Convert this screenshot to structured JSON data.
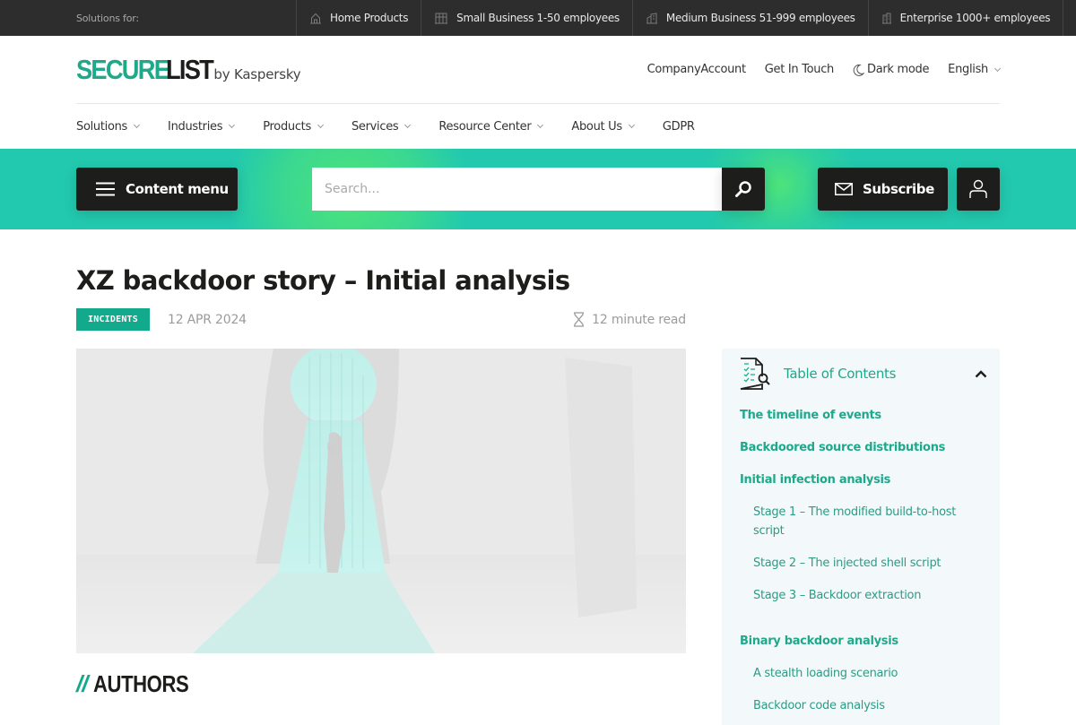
{
  "topbar": {
    "label": "Solutions for:",
    "segments": [
      {
        "label": "Home Products",
        "icon": "home-icon"
      },
      {
        "label": "Small Business 1-50 employees",
        "icon": "small-building-icon"
      },
      {
        "label": "Medium Business 51-999 employees",
        "icon": "medium-building-icon"
      },
      {
        "label": "Enterprise 1000+ employees",
        "icon": "enterprise-building-icon"
      }
    ]
  },
  "header": {
    "logo_secure": "SECURE",
    "logo_list": "LIST",
    "logo_by": "by Kaspersky",
    "links": {
      "company_account": "CompanyAccount",
      "get_in_touch": "Get In Touch",
      "dark_mode": "Dark mode",
      "language": "English"
    }
  },
  "nav": {
    "items": [
      {
        "label": "Solutions",
        "dropdown": true
      },
      {
        "label": "Industries",
        "dropdown": true
      },
      {
        "label": "Products",
        "dropdown": true
      },
      {
        "label": "Services",
        "dropdown": true
      },
      {
        "label": "Resource Center",
        "dropdown": true
      },
      {
        "label": "About Us",
        "dropdown": true
      },
      {
        "label": "GDPR",
        "dropdown": false
      }
    ]
  },
  "toolbar": {
    "content_menu_label": "Content menu",
    "search_placeholder": "Search...",
    "subscribe_label": "Subscribe"
  },
  "article": {
    "title": "XZ backdoor story – Initial analysis",
    "tag": "INCIDENTS",
    "date": "12 APR 2024",
    "read_time": "12 minute read",
    "authors_prefix": "//",
    "authors_heading": "AUTHORS"
  },
  "toc": {
    "title": "Table of Contents",
    "items": [
      {
        "label": "The timeline of events",
        "level": 1
      },
      {
        "label": "Backdoored source distributions",
        "level": 1
      },
      {
        "label": "Initial infection analysis",
        "level": 1
      },
      {
        "label": "Stage 1 – The modified build-to-host script",
        "level": 2
      },
      {
        "label": "Stage 2 – The injected shell script",
        "level": 2
      },
      {
        "label": "Stage 3 – Backdoor extraction",
        "level": 2
      },
      {
        "label": "Binary backdoor analysis",
        "level": 1
      },
      {
        "label": "A stealth loading scenario",
        "level": 2
      },
      {
        "label": "Backdoor code analysis",
        "level": 2
      }
    ]
  },
  "colors": {
    "brand_green": "#1fa88a",
    "tag_green": "#12a98d",
    "band_teal": "#22c9ae",
    "band_glow": "#4de37a",
    "dark": "#1d1d1b",
    "topbar": "#2d2d2d"
  }
}
